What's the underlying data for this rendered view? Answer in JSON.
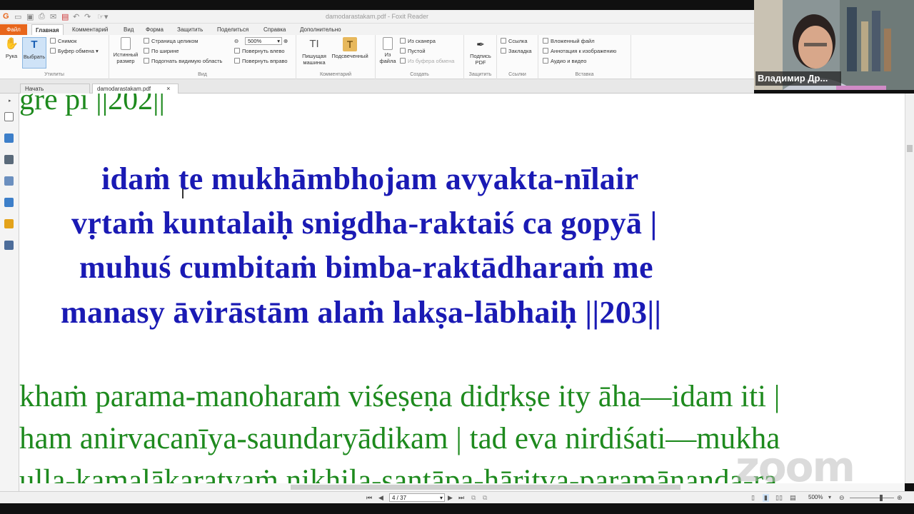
{
  "window": {
    "title": "damodarastakam.pdf - Foxit Reader"
  },
  "menu": {
    "tabs": [
      "Файл",
      "Главная",
      "Комментарий",
      "Вид",
      "Форма",
      "Защитить",
      "Поделиться",
      "Справка",
      "Дополнительно"
    ]
  },
  "ribbon": {
    "hand_label": "Рука",
    "select_label": "Выбрать",
    "snapshot_label": "Снимок",
    "clipboard_label": "Буфер обмена",
    "group_utilities": "Утилиты",
    "actual_size_label": "Истинный размер",
    "fit_page_label": "Страница целиком",
    "fit_width_label": "По ширине",
    "fit_visible_label": "Подогнать видимую область",
    "zoom_value": "500%",
    "rotate_left_label": "Повернуть влево",
    "rotate_right_label": "Повернуть вправо",
    "group_view": "Вид",
    "typewriter_label": "Пишущая машинка",
    "highlight_label": "Подсвеченный",
    "group_comment": "Комментарий",
    "from_file_label": "Из файла",
    "from_scanner_label": "Из сканера",
    "blank_label": "Пустой",
    "from_clipboard_label": "Из буфера обмена",
    "group_create": "Создать",
    "sign_label": "Подпись PDF",
    "group_protect": "Защитить",
    "link_label": "Ссылка",
    "bookmark_label": "Закладка",
    "group_links": "Ссылки",
    "attach_file_label": "Вложенный файл",
    "image_annot_label": "Аннотация к изображению",
    "audio_video_label": "Аудио и видео",
    "group_insert": "Вставка"
  },
  "doc_tabs": [
    {
      "label": "Начать"
    },
    {
      "label": "damodarastakam.pdf"
    }
  ],
  "document": {
    "top_partial": "gre pi ||202||",
    "verse_lines": [
      "idaṁ te mukhāmbhojam avyakta-nīlair",
      "vṛtaṁ kuntalaiḥ snigdha-raktaiś ca gopyā |",
      "muhuś cumbitaṁ bimba-raktādharaṁ me",
      "manasy āvirāstām alaṁ lakṣa-lābhaiḥ ||203||"
    ],
    "commentary_lines": [
      "khaṁ parama-manoharaṁ viśeṣeṇa didṛkṣe ity āha—idam iti |",
      "ham anirvacanīya-saundaryādikam | tad eva nirdiśati—mukha",
      "ulla-kamalākaratvaṁ nikhila-santāpa-hāritva-paramānanda-ra"
    ]
  },
  "statusbar": {
    "page_field": "4 / 37",
    "zoom": "500%"
  },
  "webcam": {
    "participant_name": "Владимир Др..."
  },
  "overlay": {
    "watermark": "zoom"
  }
}
